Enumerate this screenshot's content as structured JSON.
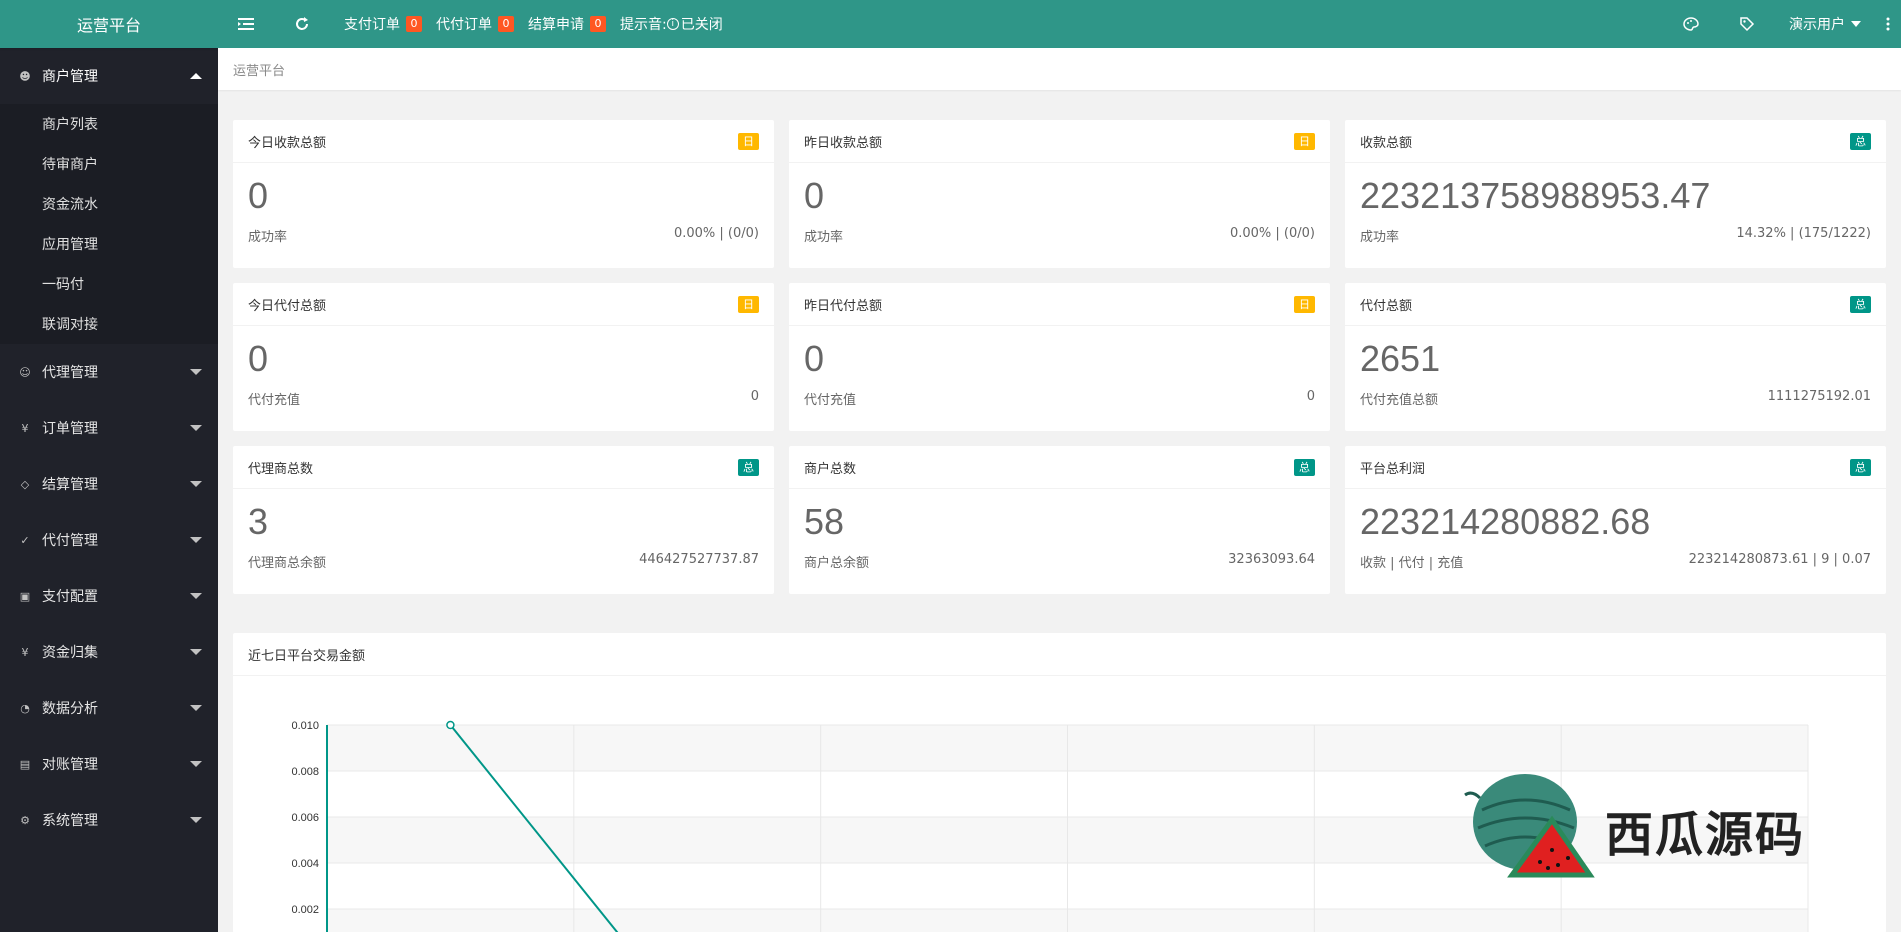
{
  "sidebar": {
    "title": "运营平台",
    "menus": [
      {
        "label": "商户管理",
        "icon": "user-group-icon",
        "open": true,
        "children": [
          "商户列表",
          "待审商户",
          "资金流水",
          "应用管理",
          "一码付",
          "联调对接"
        ]
      },
      {
        "label": "代理管理",
        "icon": "user-icon"
      },
      {
        "label": "订单管理",
        "icon": "yen-icon"
      },
      {
        "label": "结算管理",
        "icon": "diamond-icon"
      },
      {
        "label": "代付管理",
        "icon": "shield-check-icon"
      },
      {
        "label": "支付配置",
        "icon": "cube-icon"
      },
      {
        "label": "资金归集",
        "icon": "yen-circle-icon"
      },
      {
        "label": "数据分析",
        "icon": "dashboard-icon"
      },
      {
        "label": "对账管理",
        "icon": "ledger-icon"
      },
      {
        "label": "系统管理",
        "icon": "gear-icon"
      }
    ]
  },
  "header": {
    "links": [
      {
        "label": "支付订单",
        "count": "0"
      },
      {
        "label": "代付订单",
        "count": "0"
      },
      {
        "label": "结算申请",
        "count": "0"
      }
    ],
    "hint_label": "提示音:",
    "hint_icon": "i",
    "hint_value": "已关闭",
    "user": "演示用户"
  },
  "breadcrumb": "运营平台",
  "cards": [
    {
      "title": "今日收款总额",
      "tag": "日",
      "tag_type": "day",
      "value": "0",
      "foot_label": "成功率",
      "foot_value": "0.00% | (0/0)"
    },
    {
      "title": "昨日收款总额",
      "tag": "日",
      "tag_type": "day",
      "value": "0",
      "foot_label": "成功率",
      "foot_value": "0.00% | (0/0)"
    },
    {
      "title": "收款总额",
      "tag": "总",
      "tag_type": "total",
      "value": "223213758988953.47",
      "foot_label": "成功率",
      "foot_value": "14.32% | (175/1222)"
    },
    {
      "title": "今日代付总额",
      "tag": "日",
      "tag_type": "day",
      "value": "0",
      "foot_label": "代付充值",
      "foot_value": "0"
    },
    {
      "title": "昨日代付总额",
      "tag": "日",
      "tag_type": "day",
      "value": "0",
      "foot_label": "代付充值",
      "foot_value": "0"
    },
    {
      "title": "代付总额",
      "tag": "总",
      "tag_type": "total",
      "value": "2651",
      "foot_label": "代付充值总额",
      "foot_value": "1111275192.01"
    },
    {
      "title": "代理商总数",
      "tag": "总",
      "tag_type": "total",
      "value": "3",
      "foot_label": "代理商总余额",
      "foot_value": "446427527737.87"
    },
    {
      "title": "商户总数",
      "tag": "总",
      "tag_type": "total",
      "value": "58",
      "foot_label": "商户总余额",
      "foot_value": "32363093.64"
    },
    {
      "title": "平台总利润",
      "tag": "总",
      "tag_type": "total",
      "value": "223214280882.68",
      "foot_label": "收款 | 代付 | 充值",
      "foot_value": "223214280873.61 | 9 | 0.07"
    }
  ],
  "chart_title": "近七日平台交易金额",
  "chart_data": {
    "type": "line",
    "title": "近七日平台交易金额",
    "ylim": [
      0,
      0.01
    ],
    "y_ticks": [
      "0.010",
      "0.008",
      "0.006",
      "0.004",
      "0.002"
    ],
    "x_count": 7,
    "series": [
      {
        "values": [
          0.01,
          0
        ]
      }
    ],
    "color": "#009688"
  },
  "watermark": "西瓜源码"
}
